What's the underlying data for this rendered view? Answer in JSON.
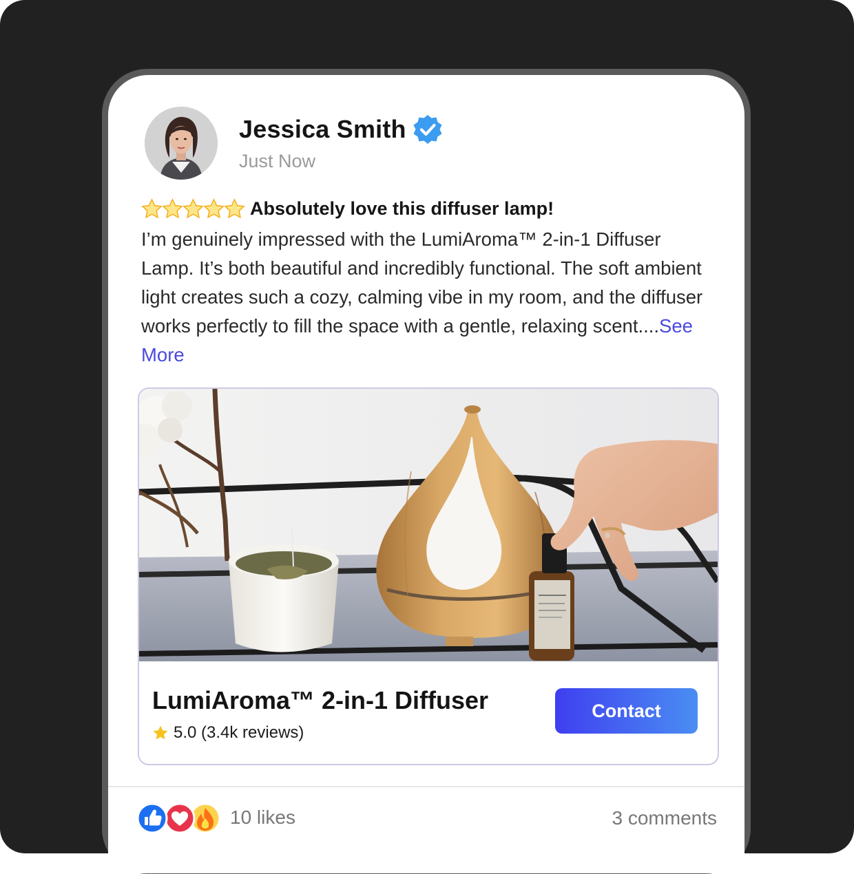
{
  "post": {
    "author_name": "Jessica Smith",
    "timestamp": "Just Now",
    "rating_stars": 5,
    "review_title": "Absolutely love this diffuser lamp!",
    "review_body": "I’m genuinely impressed with the LumiAroma™ 2-in-1 Diffuser Lamp. It’s both beautiful and incredibly functional. The soft ambient light creates such a cozy, calming vibe in my room, and the diffuser works perfectly to fill the space with a gentle, relaxing scent....",
    "see_more_label": "See More"
  },
  "product": {
    "name": "LumiAroma™ 2-in-1 Diffuser",
    "rating_text": "5.0 (3.4k reviews)",
    "contact_label": "Contact"
  },
  "footer": {
    "reactions": [
      "like-icon",
      "heart-icon",
      "fire-icon"
    ],
    "likes_text": "10 likes",
    "comments_text": "3 comments"
  },
  "colors": {
    "verified_badge": "#3b9cf0",
    "link": "#4a4ae0",
    "button_gradient_start": "#3f3ff0",
    "button_gradient_end": "#4a8ef2",
    "star": "#f7c21b"
  }
}
